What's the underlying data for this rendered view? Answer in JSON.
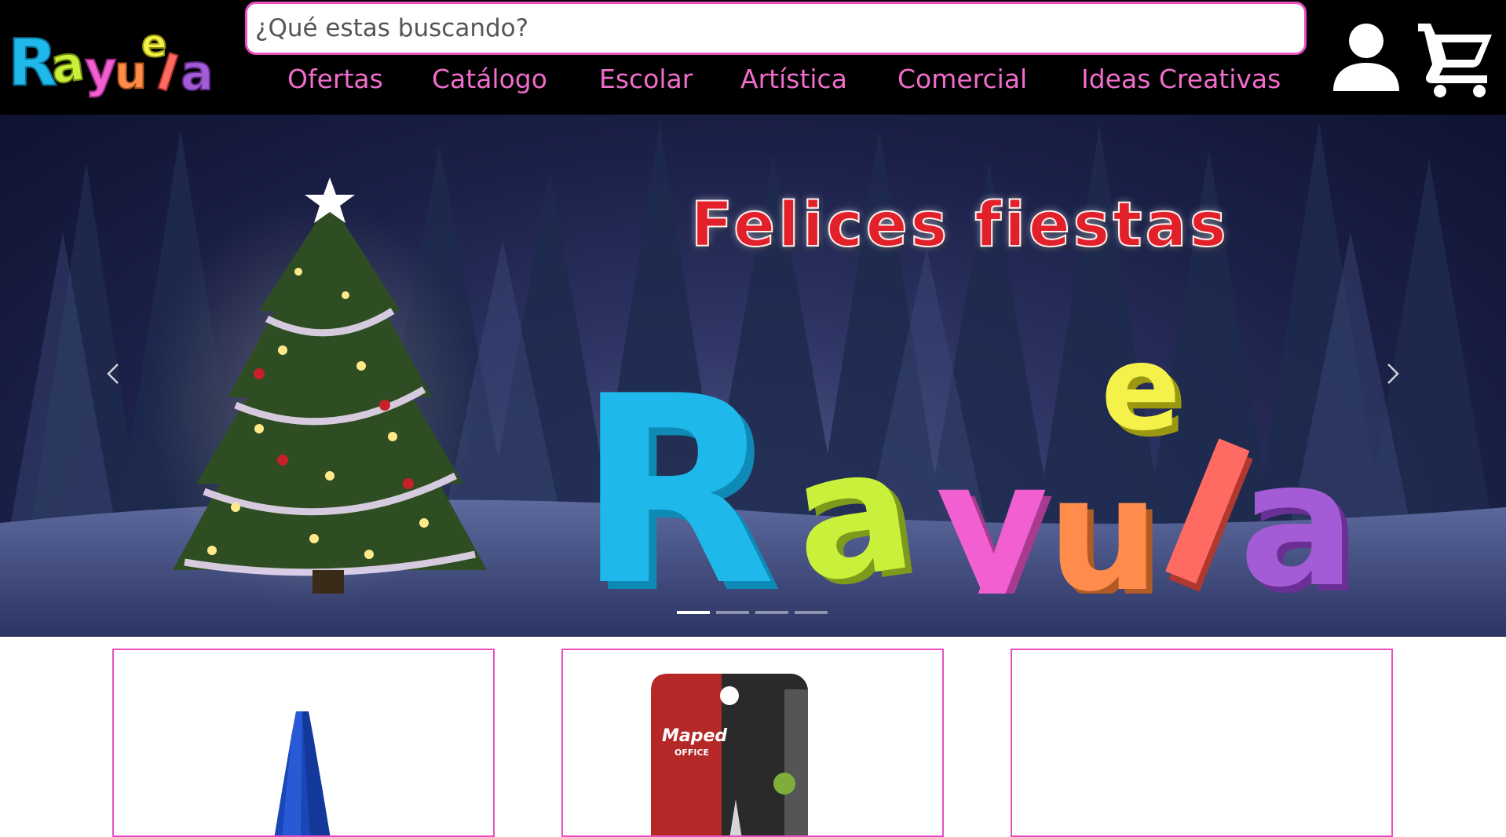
{
  "header": {
    "logo_text": "Rayuela",
    "search": {
      "placeholder": "¿Qué estas buscando?",
      "value": ""
    },
    "nav": [
      {
        "label": "Ofertas"
      },
      {
        "label": "Catálogo"
      },
      {
        "label": "Escolar"
      },
      {
        "label": "Artística"
      },
      {
        "label": "Comercial"
      },
      {
        "label": "Ideas Creativas"
      }
    ],
    "user_icon": "user-icon",
    "cart_icon": "cart-icon"
  },
  "hero": {
    "title": "Felices fiestas",
    "brand_text": "Rayuela",
    "prev_icon": "chevron-left-icon",
    "next_icon": "chevron-right-icon",
    "slides_count": 4,
    "active_slide": 1
  },
  "products": [
    {
      "image": "blue-pencil-sharpener"
    },
    {
      "image": "maped-office-scissors",
      "brand_text": "Maped",
      "sub_text": "OFFICE"
    },
    {
      "image": ""
    }
  ],
  "colors": {
    "header_bg": "#000000",
    "accent_pink": "#ea4fc0",
    "nav_text": "#f06dcc",
    "hero_title_red": "#e2202a",
    "brand_blue": "#1fb8ea",
    "brand_lime": "#c9f03a",
    "brand_pink": "#f25fd1",
    "brand_orange": "#ff8c4a",
    "brand_yellow": "#f4f24a",
    "brand_coral": "#ff6b62",
    "brand_purple": "#a35bd6"
  }
}
